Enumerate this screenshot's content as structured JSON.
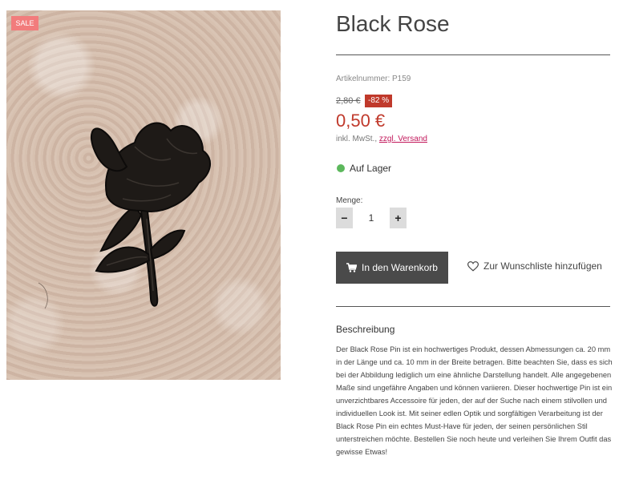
{
  "product": {
    "badge": "SALE",
    "title": "Black Rose",
    "sku_label": "Artikelnummer: P159",
    "old_price": "2,80 €",
    "discount": "-82 %",
    "price": "0,50 €",
    "tax_text": "inkl. MwSt.,",
    "shipping_link": "zzgl. Versand",
    "stock_status": "Auf Lager",
    "stock_color": "#5cb85c",
    "price_color": "#c0392b"
  },
  "quantity": {
    "label": "Menge:",
    "value": "1",
    "minus": "−",
    "plus": "+"
  },
  "actions": {
    "cart_label": "In den Warenkorb",
    "cart_icon": "cart-icon",
    "wishlist_label": "Zur Wunschliste hinzufügen",
    "wishlist_icon": "heart-icon"
  },
  "description": {
    "heading": "Beschreibung",
    "text": "Der Black Rose Pin ist ein hochwertiges Produkt, dessen Abmessungen ca. 20 mm in der Länge und ca. 10 mm in der Breite betragen. Bitte beachten Sie, dass es sich bei der Abbildung lediglich um eine ähnliche Darstellung handelt. Alle angegebenen Maße sind ungefähre Angaben und können variieren. Dieser hochwertige Pin ist ein unverzichtbares Accessoire für jeden, der auf der Suche nach einem stilvollen und individuellen Look ist. Mit seiner edlen Optik und sorgfältigen Verarbeitung ist der Black Rose Pin ein echtes Must-Have für jeden, der seinen persönlichen Stil unterstreichen möchte. Bestellen Sie noch heute und verleihen Sie Ihrem Outfit das gewisse Etwas!"
  }
}
